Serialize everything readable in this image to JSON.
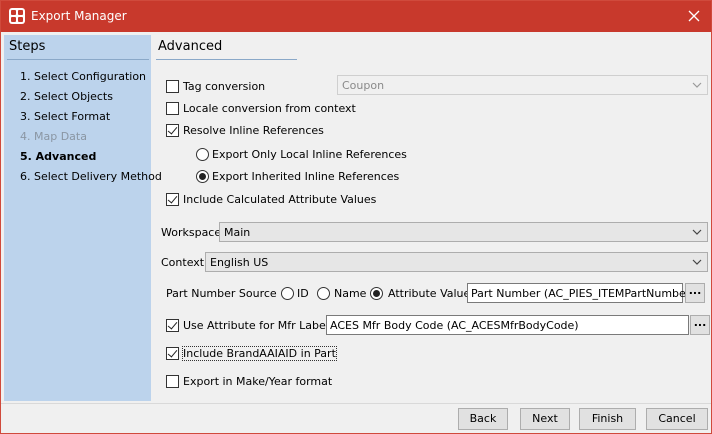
{
  "window": {
    "title": "Export Manager",
    "accent_color": "#c8392c"
  },
  "steps": {
    "heading": "Steps",
    "items": [
      {
        "label": "1. Select Configuration",
        "state": "normal"
      },
      {
        "label": "2. Select Objects",
        "state": "normal"
      },
      {
        "label": "3. Select Format",
        "state": "normal"
      },
      {
        "label": "4. Map Data",
        "state": "disabled"
      },
      {
        "label": "5. Advanced",
        "state": "current"
      },
      {
        "label": "6. Select Delivery Method",
        "state": "normal"
      }
    ]
  },
  "panel": {
    "title": "Advanced",
    "tag_conversion": {
      "label": "Tag conversion",
      "checked": false,
      "select_value": "Coupon",
      "select_enabled": false
    },
    "locale_conversion": {
      "label": "Locale conversion from context",
      "checked": false
    },
    "resolve_inline": {
      "label": "Resolve Inline References",
      "checked": true
    },
    "export_only_local": {
      "label": "Export Only Local Inline References",
      "selected": false
    },
    "export_inherited": {
      "label": "Export Inherited Inline References",
      "selected": true
    },
    "include_calculated": {
      "label": "Include Calculated Attribute Values",
      "checked": true
    },
    "workspace": {
      "label": "Workspace",
      "value": "Main"
    },
    "context": {
      "label": "Context",
      "value": "English US"
    },
    "part_number_source": {
      "label": "Part Number Source",
      "options": [
        {
          "label": "ID",
          "selected": false
        },
        {
          "label": "Name",
          "selected": false
        },
        {
          "label": "Attribute Value",
          "selected": true
        }
      ],
      "value": "Part Number (AC_PIES_ITEMPartNumber)",
      "browse_label": "..."
    },
    "mfr_label": {
      "label": "Use Attribute for Mfr Label",
      "checked": true,
      "value": "ACES Mfr Body Code (AC_ACESMfrBodyCode)",
      "browse_label": "..."
    },
    "include_brand": {
      "label": "Include BrandAAIAID in Part",
      "checked": true
    },
    "make_year": {
      "label": "Export in Make/Year format",
      "checked": false
    }
  },
  "footer": {
    "back": "Back",
    "next": "Next",
    "finish": "Finish",
    "cancel": "Cancel"
  }
}
